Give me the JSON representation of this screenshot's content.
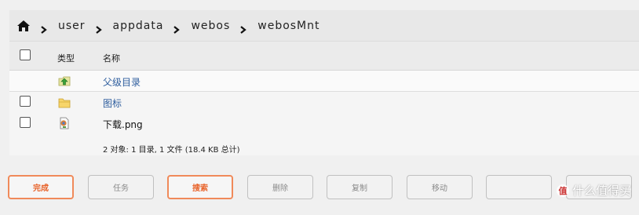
{
  "breadcrumb": [
    "user",
    "appdata",
    "webos",
    "webosMnt"
  ],
  "table": {
    "col_type": "类型",
    "col_name": "名称"
  },
  "rows": [
    {
      "name": "父级目录",
      "icon": "parent-folder-icon",
      "checkbox": false
    },
    {
      "name": "图标",
      "icon": "folder-icon",
      "checkbox": true
    },
    {
      "name": "下载.png",
      "icon": "image-file-icon",
      "checkbox": true
    }
  ],
  "summary": "2 对象: 1 目录, 1 文件 (18.4 KB 总计)",
  "toolbar": {
    "buttons": [
      {
        "label": "完成",
        "active": true
      },
      {
        "label": "任务",
        "active": false
      },
      {
        "label": "搜索",
        "active": true
      },
      {
        "label": "删除",
        "active": false
      },
      {
        "label": "复制",
        "active": false
      },
      {
        "label": "移动",
        "active": false
      },
      {
        "label": "",
        "active": false
      },
      {
        "label": "",
        "active": false
      }
    ]
  },
  "watermark": {
    "badge": "值",
    "text": "什么值得买"
  },
  "colors": {
    "accent": "#e8632a",
    "link": "#2f5e9e",
    "folder": "#f3c24a"
  }
}
